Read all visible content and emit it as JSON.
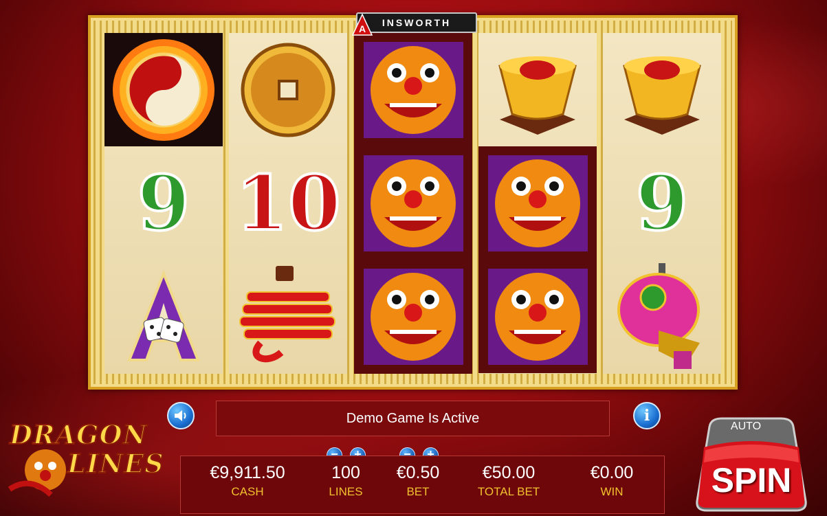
{
  "brand": {
    "name": "INSWORTH",
    "letter": "A"
  },
  "game_logo": {
    "line1": "DRAGON",
    "line2": "LINES"
  },
  "message": "Demo Game Is Active",
  "stats": {
    "cash": {
      "value": "€9,911.50",
      "label": "CASH"
    },
    "lines": {
      "value": "100",
      "label": "LINES"
    },
    "bet": {
      "value": "€0.50",
      "label": "BET"
    },
    "total_bet": {
      "value": "€50.00",
      "label": "TOTAL BET"
    },
    "win": {
      "value": "€0.00",
      "label": "WIN"
    }
  },
  "controls": {
    "minus": "−",
    "plus": "+",
    "spin": "SPIN",
    "auto": "AUTO",
    "info": "i"
  },
  "reels": [
    [
      "yin-yang-dragon",
      "9",
      "A-dice"
    ],
    [
      "gold-coin",
      "10",
      "firecrackers"
    ],
    [
      "dragon-mask",
      "dragon-mask",
      "dragon-mask"
    ],
    [
      "gold-ingot",
      "dragon-mask",
      "dragon-mask"
    ],
    [
      "gold-ingot",
      "9",
      "pink-lantern"
    ]
  ],
  "colors": {
    "gold": "#f2c12e",
    "red": "#c8161a",
    "green_symbol": "#2e9a2e",
    "red_symbol": "#c81414",
    "purple_symbol": "#7a2bb0"
  }
}
